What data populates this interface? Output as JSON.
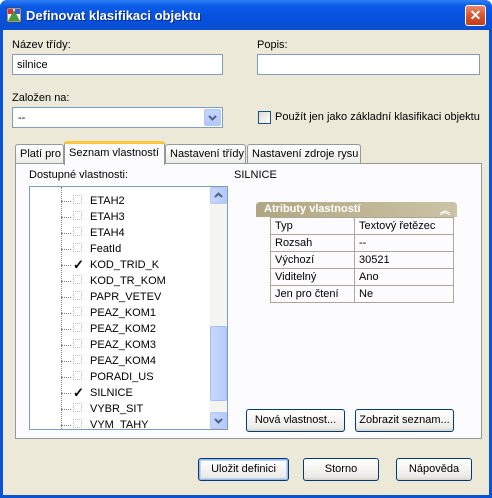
{
  "window": {
    "title": "Definovat klasifikaci objektu",
    "close_glyph": "✕"
  },
  "form": {
    "class_name_label": "Název třídy:",
    "class_name_value": "silnice",
    "description_label": "Popis:",
    "description_value": "",
    "based_on_label": "Založen na:",
    "based_on_value": "--",
    "base_only_label": "Použít jen jako základní klasifikaci objektu"
  },
  "tabs": [
    {
      "label": "Platí pro",
      "active": false
    },
    {
      "label": "Seznam vlastností",
      "active": true
    },
    {
      "label": "Nastavení třídy",
      "active": false
    },
    {
      "label": "Nastavení zdroje rysu",
      "active": false
    }
  ],
  "properties_panel": {
    "available_label": "Dostupné vlastnosti:",
    "items": [
      {
        "label": "ETAH2",
        "checked": false
      },
      {
        "label": "ETAH3",
        "checked": false
      },
      {
        "label": "ETAH4",
        "checked": false
      },
      {
        "label": "FeatId",
        "checked": false
      },
      {
        "label": "KOD_TRID_K",
        "checked": true
      },
      {
        "label": "KOD_TR_KOM",
        "checked": false
      },
      {
        "label": "PAPR_VETEV",
        "checked": false
      },
      {
        "label": "PEAZ_KOM1",
        "checked": false
      },
      {
        "label": "PEAZ_KOM2",
        "checked": false
      },
      {
        "label": "PEAZ_KOM3",
        "checked": false
      },
      {
        "label": "PEAZ_KOM4",
        "checked": false
      },
      {
        "label": "PORADI_US",
        "checked": false
      },
      {
        "label": "SILNICE",
        "checked": true
      },
      {
        "label": "VYBR_SIT",
        "checked": false
      },
      {
        "label": "VYM_TAHY",
        "checked": false
      }
    ],
    "selected_title": "SILNICE",
    "attributes_header": "Atributy vlastností",
    "attributes": [
      {
        "name": "Typ",
        "value": "Textový řetězec"
      },
      {
        "name": "Rozsah",
        "value": "--"
      },
      {
        "name": "Výchozí",
        "value": "30521"
      },
      {
        "name": "Viditelný",
        "value": "Ano"
      },
      {
        "name": "Jen pro čtení",
        "value": "Ne"
      }
    ],
    "new_property_button": "Nová vlastnost...",
    "show_list_button": "Zobrazit seznam..."
  },
  "buttons": {
    "save": "Uložit definici",
    "cancel": "Storno",
    "help": "Nápověda"
  },
  "icons": [
    "app-icon",
    "close-icon",
    "dropdown-arrow-icon",
    "scroll-up-icon",
    "scroll-down-icon",
    "collapse-icon"
  ]
}
